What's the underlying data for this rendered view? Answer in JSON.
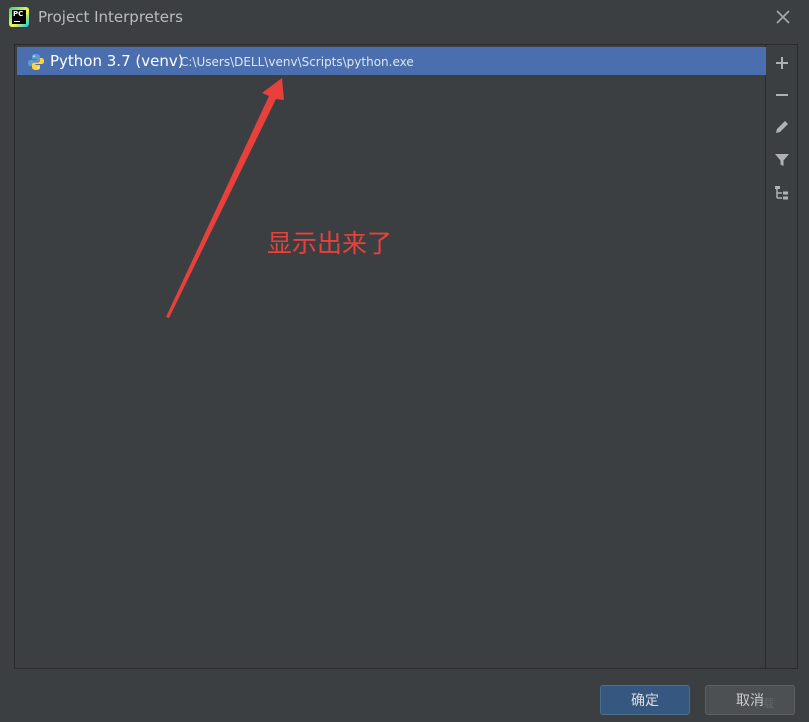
{
  "window": {
    "title": "Project Interpreters",
    "app_icon": "pycharm-logo",
    "app_icon_text": "PC",
    "close_icon": "close-icon"
  },
  "interpreters": [
    {
      "name": "Python 3.7 (venv)",
      "path": "C:\\Users\\DELL\\venv\\Scripts\\python.exe",
      "icon": "python-icon",
      "selected": true
    }
  ],
  "toolbar": {
    "buttons": [
      {
        "name": "add",
        "icon": "plus-icon"
      },
      {
        "name": "remove",
        "icon": "minus-icon"
      },
      {
        "name": "edit",
        "icon": "pencil-icon"
      },
      {
        "name": "filter",
        "icon": "filter-icon"
      },
      {
        "name": "show-paths",
        "icon": "tree-paths-icon"
      }
    ]
  },
  "annotation": {
    "text": "显示出来了",
    "color": "#e8413c"
  },
  "footer": {
    "ok_label": "确定",
    "cancel_label": "取消"
  },
  "watermark": {
    "text": "下载"
  },
  "colors": {
    "background": "#3c3f41",
    "selection": "#4b6eaf",
    "primary_button": "#365880"
  }
}
